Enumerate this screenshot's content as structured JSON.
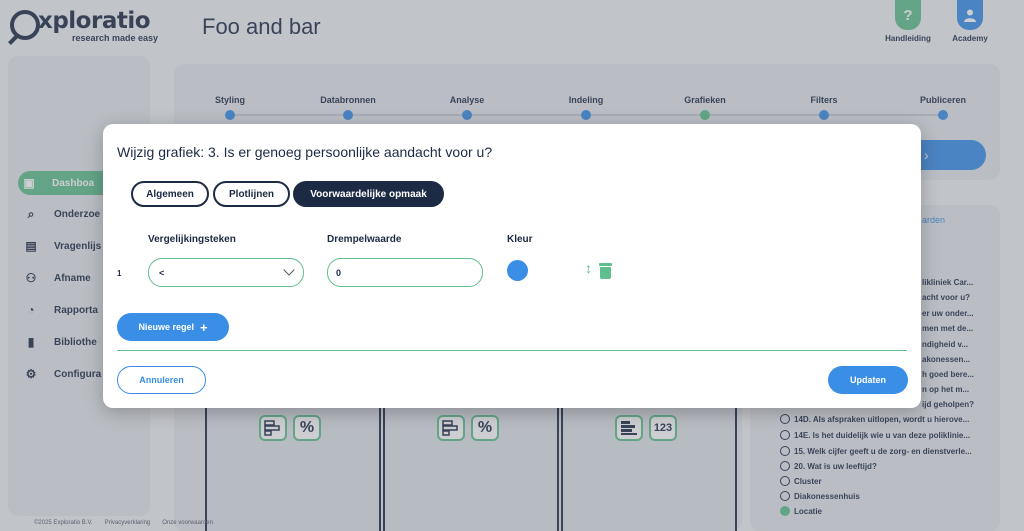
{
  "brand": {
    "logo_text": "xploratio",
    "tagline": "research made easy"
  },
  "app": {
    "title": "Foo and bar"
  },
  "top_buttons": [
    {
      "label": "Handleiding",
      "icon": "question-icon",
      "glyph": "?",
      "color": "#5fbf8c"
    },
    {
      "label": "Academy",
      "icon": "user-icon",
      "color": "#3a8ee6"
    }
  ],
  "sidebar": {
    "items": [
      {
        "label": "Dashboa",
        "icon": "dashboard-icon",
        "active": true
      },
      {
        "label": "Onderzoe",
        "icon": "search-icon"
      },
      {
        "label": "Vragenlijs",
        "icon": "document-icon"
      },
      {
        "label": "Afname",
        "icon": "users-icon"
      },
      {
        "label": "Rapporta",
        "icon": "pie-chart-icon"
      },
      {
        "label": "Bibliothe",
        "icon": "book-icon"
      },
      {
        "label": "Configura",
        "icon": "gears-icon"
      }
    ]
  },
  "steps": [
    {
      "label": "Styling"
    },
    {
      "label": "Databronnen"
    },
    {
      "label": "Analyse"
    },
    {
      "label": "Indeling"
    },
    {
      "label": "Grafieken",
      "active": true
    },
    {
      "label": "Filters"
    },
    {
      "label": "Publiceren"
    }
  ],
  "right_panel": {
    "link_text": "arden",
    "truncated_items": [
      "likliniek Car...",
      "acht voor u?",
      "er uw onder...",
      "men met de...",
      "ndigheid v...",
      "akonessen...",
      "h goed bere...",
      "n op het m...",
      "ijd geholpen?"
    ],
    "items": [
      "14D. Als afspraken uitlopen, wordt u hierove...",
      "14E. Is het duidelijk wie u van deze poliklinie...",
      "15. Welk cijfer geeft u de zorg- en dienstverle...",
      "20. Wat is uw leeftijd?",
      "Cluster",
      "Diakonessenhuis",
      "Locatie"
    ]
  },
  "cards": {
    "number_icon_text": "123",
    "percent_icon_text": "%"
  },
  "footer": {
    "copyright": "©2025 Exploratio B.V.",
    "privacy": "Privacyverklaring",
    "terms": "Onze voorwaarden"
  },
  "modal": {
    "title": "Wijzig grafiek: 3. Is er genoeg persoonlijke aandacht voor u?",
    "tabs": [
      {
        "label": "Algemeen",
        "active": false
      },
      {
        "label": "Plotlijnen",
        "active": false
      },
      {
        "label": "Voorwaardelijke opmaak",
        "active": true
      }
    ],
    "columns": {
      "comparator": "Vergelijkingsteken",
      "threshold": "Drempelwaarde",
      "color": "Kleur"
    },
    "rule": {
      "number": "1",
      "comparator": "<",
      "threshold": "0",
      "color": "#3a8ee6"
    },
    "new_rule_label": "Nieuwe regel",
    "cancel_label": "Annuleren",
    "update_label": "Updaten"
  }
}
